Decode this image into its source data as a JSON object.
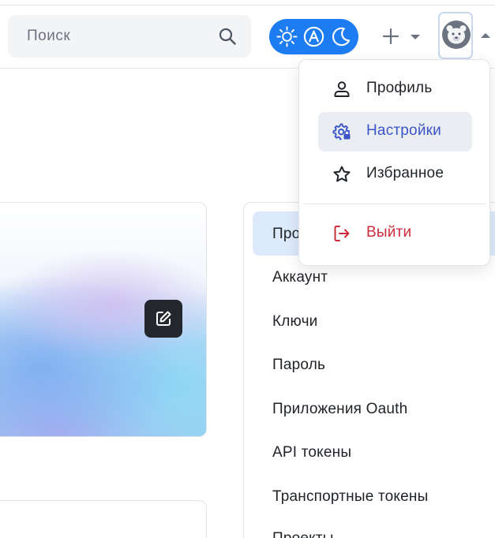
{
  "header": {
    "search": {
      "placeholder": "Поиск",
      "icon": "search-icon"
    },
    "theme_switch": {
      "options": [
        "sun-icon",
        "auto-theme-icon",
        "moon-icon"
      ],
      "accent": "#1d7cf2"
    },
    "create": {
      "icon": "plus-icon"
    },
    "user_avatar": {
      "icon": "bear-avatar"
    }
  },
  "user_menu": {
    "items": [
      {
        "label": "Профиль",
        "icon": "user-icon",
        "color": "#1f2328"
      },
      {
        "label": "Настройки",
        "icon": "settings-icon",
        "color": "#3b55c9",
        "active": true
      },
      {
        "label": "Избранное",
        "icon": "star-icon",
        "color": "#1f2328"
      }
    ],
    "logout": {
      "label": "Выйти",
      "icon": "logout-icon",
      "color": "#cc2b3b"
    }
  },
  "settings_nav": {
    "items": [
      "Про",
      "Аккаунт",
      "Ключи",
      "Пароль",
      "Приложения Oauth",
      "API токены",
      "Транспортные токены",
      "Проекты"
    ]
  },
  "colors": {
    "nav_active_bg": "#ddeafb",
    "menu_active_bg": "#eaedf2",
    "edit_button_bg": "#24272d"
  }
}
